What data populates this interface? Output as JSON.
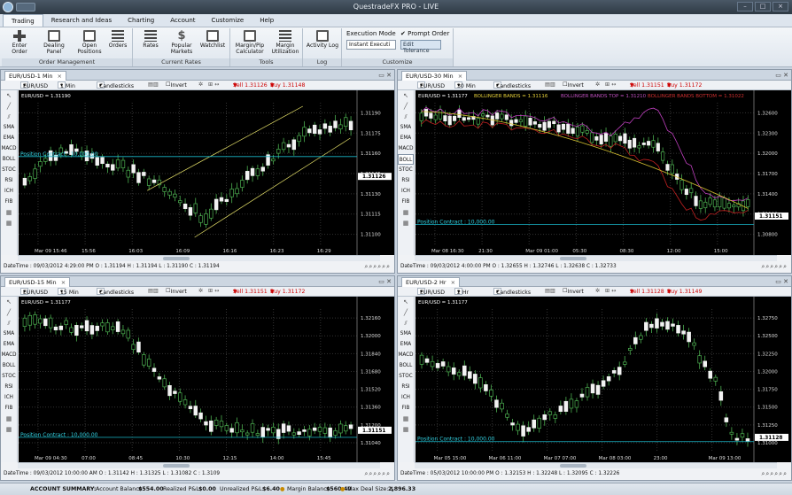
{
  "app": {
    "title": "QuestradeFX PRO - LIVE"
  },
  "window_controls": {
    "minimize": "–",
    "maximize": "□",
    "close": "×"
  },
  "menu": [
    "Trading",
    "Research and Ideas",
    "Charting",
    "Account",
    "Customize",
    "Help"
  ],
  "ribbon": {
    "groups": {
      "order_management": "Order Management",
      "current_rates": "Current Rates",
      "tools": "Tools",
      "log": "Log",
      "customize": "Customize"
    },
    "buttons": {
      "enter_order": "Enter Order",
      "dealing_panel": "Dealing Panel",
      "open_positions": "Open Positions",
      "orders": "Orders",
      "rates": "Rates",
      "popular_markets": "Popular Markets",
      "watchlist": "Watchlist",
      "margin_pip_calculator": "Margin/Pip Calculator",
      "margin_utilization": "Margin Utilization",
      "activity_log": "Activity Log"
    },
    "execution_mode": {
      "label": "Execution Mode",
      "value": "Instant Executi"
    },
    "prompt_order": {
      "label": "Prompt Order",
      "checked": true
    },
    "edit_tolerance": "Edit Tolerance"
  },
  "indicators": [
    "SMA",
    "EMA",
    "MACD",
    "BOLL",
    "STOC",
    "RSI",
    "ICH",
    "FIB"
  ],
  "common": {
    "invert": "Invert",
    "chart_type": "Candlesticks",
    "symbol": "EUR/USD",
    "position_contract": "Position  Contract : 10,000.00"
  },
  "charts": [
    {
      "tab": "EUR/USD-1 Min",
      "timeframe": "1 Min",
      "sell": "Sell 1.31126",
      "buy": "Buy 1.31148",
      "header": "EUR/USD = 1.31190",
      "overlay": "",
      "overlay2": "",
      "overlay3": "",
      "status": "DateTime : 09/03/2012 4:29:00 PM O : 1.31194 H : 1.31194 L : 1.31190 C : 1.31194",
      "current": "1.31126",
      "x_labels": [
        "Mar 09 15:46",
        "15:56",
        "16:03",
        "16:09",
        "16:16",
        "16:23",
        "16:29"
      ],
      "y_labels": [
        "1.31190",
        "1.31175",
        "1.31160",
        "1.31145",
        "1.31130",
        "1.31115",
        "1.31100"
      ]
    },
    {
      "tab": "EUR/USD-30 Min",
      "timeframe": "30 Min",
      "sell": "Sell 1.31151",
      "buy": "Buy 1.31172",
      "header": "EUR/USD = 1.31177",
      "overlay": "BOLLINGER BANDS = 1.31116",
      "overlay2": "BOLLINGER BANDS TOP = 1.31210",
      "overlay3": "BOLLINGER BANDS BOTTOM = 1.31022",
      "status": "DateTime : 09/03/2012 4:00:00 PM O : 1.32655 H : 1.32746 L : 1.32638 C : 1.32733",
      "current": "1.31151",
      "x_labels": [
        "Mar 08 16:30",
        "21:30",
        "Mar 09 01:00",
        "05:30",
        "08:30",
        "12:00",
        "15:00"
      ],
      "y_labels": [
        "1.32600",
        "1.32300",
        "1.32000",
        "1.31700",
        "1.31400",
        "1.31100",
        "1.30800"
      ]
    },
    {
      "tab": "EUR/USD-15 Min",
      "timeframe": "15 Min",
      "sell": "Sell 1.31151",
      "buy": "Buy 1.31172",
      "header": "EUR/USD = 1.31177",
      "overlay": "",
      "overlay2": "",
      "overlay3": "",
      "status": "DateTime : 09/03/2012 10:00:00 AM O : 1.31142 H : 1.31325 L : 1.31082 C : 1.3109",
      "current": "1.31151",
      "x_labels": [
        "Mar 09 04:30",
        "07:00",
        "08:45",
        "10:30",
        "12:15",
        "14:00",
        "15:45"
      ],
      "y_labels": [
        "1.32160",
        "1.32000",
        "1.31840",
        "1.31680",
        "1.31520",
        "1.31360",
        "1.31200",
        "1.31040"
      ]
    },
    {
      "tab": "EUR/USD-2 Hr",
      "timeframe": "2 Hr",
      "sell": "Sell 1.31128",
      "buy": "Buy 1.31149",
      "header": "EUR/USD = 1.31177",
      "overlay": "",
      "overlay2": "",
      "overlay3": "",
      "status": "DateTime : 05/03/2012 10:00:00 PM O : 1.32153 H : 1.32248 L : 1.32095 C : 1.32226",
      "current": "1.31128",
      "x_labels": [
        "Mar 05 15:00",
        "Mar 06 11:00",
        "Mar 07 07:00",
        "Mar 08 03:00",
        "23:00",
        "Mar 09 13:00"
      ],
      "y_labels": [
        "1.32750",
        "1.32500",
        "1.32250",
        "1.32000",
        "1.31750",
        "1.31500",
        "1.31250",
        "1.31000"
      ]
    }
  ],
  "account": {
    "summary_label": "ACCOUNT SUMMARY:",
    "balance_label": "Account Balance:",
    "balance": "$554.00",
    "realized_label": "Realized P&L:",
    "realized": "$0.00",
    "unrealized_label": "Unrealized P&L:",
    "unrealized": "$6.40",
    "margin_label": "Margin Balance:",
    "margin": "$560.40",
    "maxdeal_label": "Max Deal Size: $",
    "maxdeal": "2,896.33"
  }
}
